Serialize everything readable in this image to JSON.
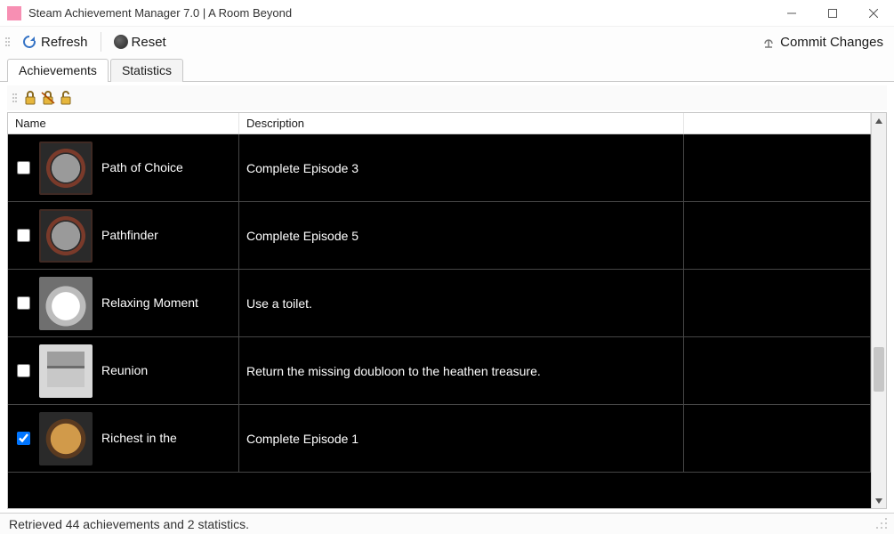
{
  "window": {
    "title": "Steam Achievement Manager 7.0 | A Room Beyond"
  },
  "toolbar": {
    "refresh_label": "Refresh",
    "reset_label": "Reset",
    "commit_label": "Commit Changes"
  },
  "tabs": {
    "items": [
      {
        "label": "Achievements",
        "active": true
      },
      {
        "label": "Statistics",
        "active": false
      }
    ]
  },
  "table": {
    "columns": {
      "name": "Name",
      "description": "Description"
    },
    "rows": [
      {
        "checked": false,
        "name": "Path of Choice",
        "description": "Complete Episode 3",
        "icon": "ach-circle"
      },
      {
        "checked": false,
        "name": "Pathfinder",
        "description": "Complete Episode 5",
        "icon": "ach-circle"
      },
      {
        "checked": false,
        "name": "Relaxing Moment",
        "description": "Use a toilet.",
        "icon": "ach-droplet"
      },
      {
        "checked": false,
        "name": "Reunion",
        "description": "Return the missing doubloon to the heathen treasure.",
        "icon": "ach-chest"
      },
      {
        "checked": true,
        "name": "Richest in the",
        "description": "Complete Episode 1",
        "icon": "ach-face"
      }
    ]
  },
  "statusbar": {
    "text": "Retrieved 44 achievements and 2 statistics."
  }
}
